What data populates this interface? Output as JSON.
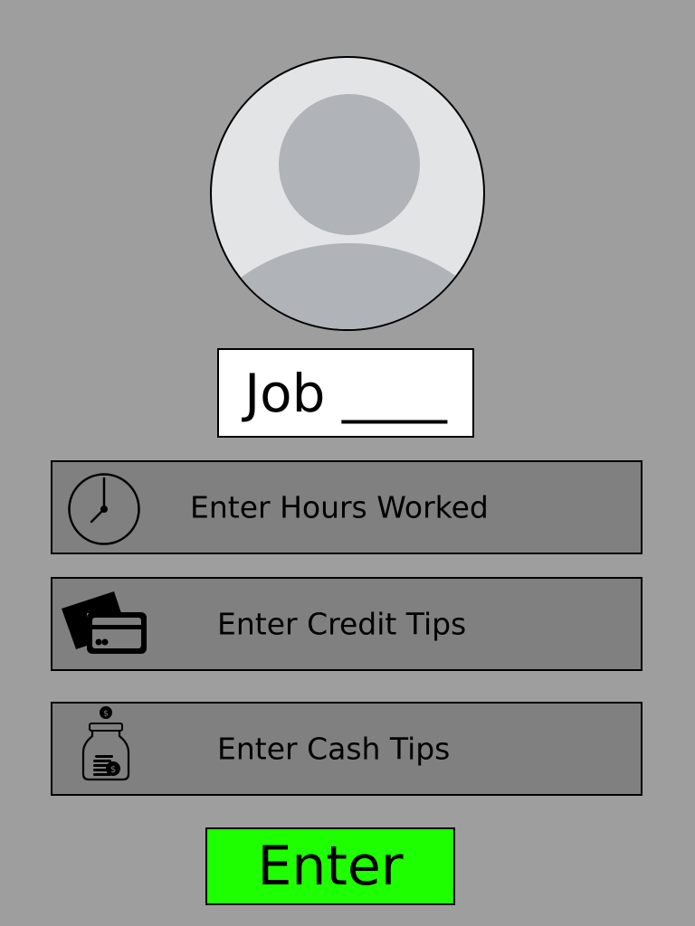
{
  "avatar": {
    "icon": "person-placeholder-icon"
  },
  "job": {
    "label": "Job ____"
  },
  "actions": [
    {
      "label": "Enter Hours Worked",
      "icon": "clock-icon"
    },
    {
      "label": "Enter Credit Tips",
      "icon": "credit-cards-icon"
    },
    {
      "label": "Enter Cash Tips",
      "icon": "tip-jar-icon"
    }
  ],
  "submit": {
    "label": "Enter",
    "color": "#1eff00"
  },
  "colors": {
    "background": "#9e9e9e",
    "row_button": "#808080",
    "avatar_bg": "#e3e4e6",
    "avatar_figure": "#b0b3b7"
  }
}
